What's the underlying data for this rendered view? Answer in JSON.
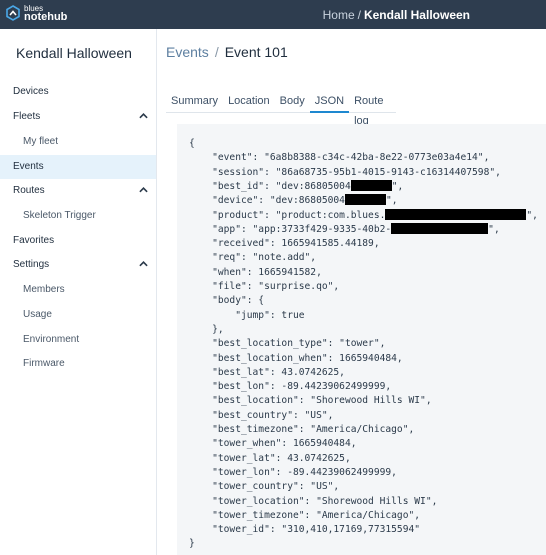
{
  "app": {
    "brand_line1": "blues",
    "brand_line2": "notehub",
    "breadcrumb_home": "Home",
    "breadcrumb_sep": "/",
    "breadcrumb_current": "Kendall Halloween"
  },
  "sidebar": {
    "project_name": "Kendall Halloween",
    "items": [
      {
        "label": "Devices",
        "level": "top",
        "expandable": false,
        "active": false
      },
      {
        "label": "Fleets",
        "level": "top",
        "expandable": true,
        "active": false
      },
      {
        "label": "My fleet",
        "level": "sub",
        "expandable": false,
        "active": false
      },
      {
        "label": "Events",
        "level": "top",
        "expandable": false,
        "active": true
      },
      {
        "label": "Routes",
        "level": "top",
        "expandable": true,
        "active": false
      },
      {
        "label": "Skeleton Trigger",
        "level": "sub",
        "expandable": false,
        "active": false
      },
      {
        "label": "Favorites",
        "level": "top",
        "expandable": false,
        "active": false
      },
      {
        "label": "Settings",
        "level": "top",
        "expandable": true,
        "active": false
      },
      {
        "label": "Members",
        "level": "sub",
        "expandable": false,
        "active": false
      },
      {
        "label": "Usage",
        "level": "sub",
        "expandable": false,
        "active": false
      },
      {
        "label": "Environment",
        "level": "sub",
        "expandable": false,
        "active": false
      },
      {
        "label": "Firmware",
        "level": "sub",
        "expandable": false,
        "active": false
      }
    ]
  },
  "page": {
    "crumb_parent": "Events",
    "crumb_sep": "/",
    "crumb_current": "Event 101",
    "tabs": [
      {
        "label": "Summary",
        "active": false
      },
      {
        "label": "Location",
        "active": false
      },
      {
        "label": "Body",
        "active": false
      },
      {
        "label": "JSON",
        "active": true
      },
      {
        "label": "Route log",
        "active": false
      }
    ]
  },
  "json_lines": [
    {
      "text": "{"
    },
    {
      "text": "    \"event\": \"6a8b8388-c34c-42ba-8e22-0773e03a4e14\","
    },
    {
      "text": "    \"session\": \"86a68735-95b1-4015-9143-c16314407598\","
    },
    {
      "text": "    \"best_id\": \"dev:86805004",
      "redacted": true,
      "suffix": "\","
    },
    {
      "text": "    \"device\": \"dev:86805004",
      "redacted": true,
      "suffix": "\","
    },
    {
      "text": "    \"product\": \"product:com.blues.",
      "redacted": true,
      "suffix": "\","
    },
    {
      "text": "    \"app\": \"app:3733f429-9335-40b2-",
      "redacted": true,
      "suffix": "\","
    },
    {
      "text": "    \"received\": 1665941585.44189,"
    },
    {
      "text": "    \"req\": \"note.add\","
    },
    {
      "text": "    \"when\": 1665941582,"
    },
    {
      "text": "    \"file\": \"surprise.qo\","
    },
    {
      "text": "    \"body\": {"
    },
    {
      "text": "        \"jump\": true"
    },
    {
      "text": "    },"
    },
    {
      "text": "    \"best_location_type\": \"tower\","
    },
    {
      "text": "    \"best_location_when\": 1665940484,"
    },
    {
      "text": "    \"best_lat\": 43.0742625,"
    },
    {
      "text": "    \"best_lon\": -89.44239062499999,"
    },
    {
      "text": "    \"best_location\": \"Shorewood Hills WI\","
    },
    {
      "text": "    \"best_country\": \"US\","
    },
    {
      "text": "    \"best_timezone\": \"America/Chicago\","
    },
    {
      "text": "    \"tower_when\": 1665940484,"
    },
    {
      "text": "    \"tower_lat\": 43.0742625,"
    },
    {
      "text": "    \"tower_lon\": -89.44239062499999,"
    },
    {
      "text": "    \"tower_country\": \"US\","
    },
    {
      "text": "    \"tower_location\": \"Shorewood Hills WI\","
    },
    {
      "text": "    \"tower_timezone\": \"America/Chicago\","
    },
    {
      "text": "    \"tower_id\": \"310,410,17169,77315594\""
    },
    {
      "text": "}"
    }
  ],
  "colors": {
    "topbar": "#2e3d4f",
    "active_nav": "#e5f2fb",
    "tab_underline": "#1e88d0",
    "json_bg": "#f4f6f8"
  }
}
